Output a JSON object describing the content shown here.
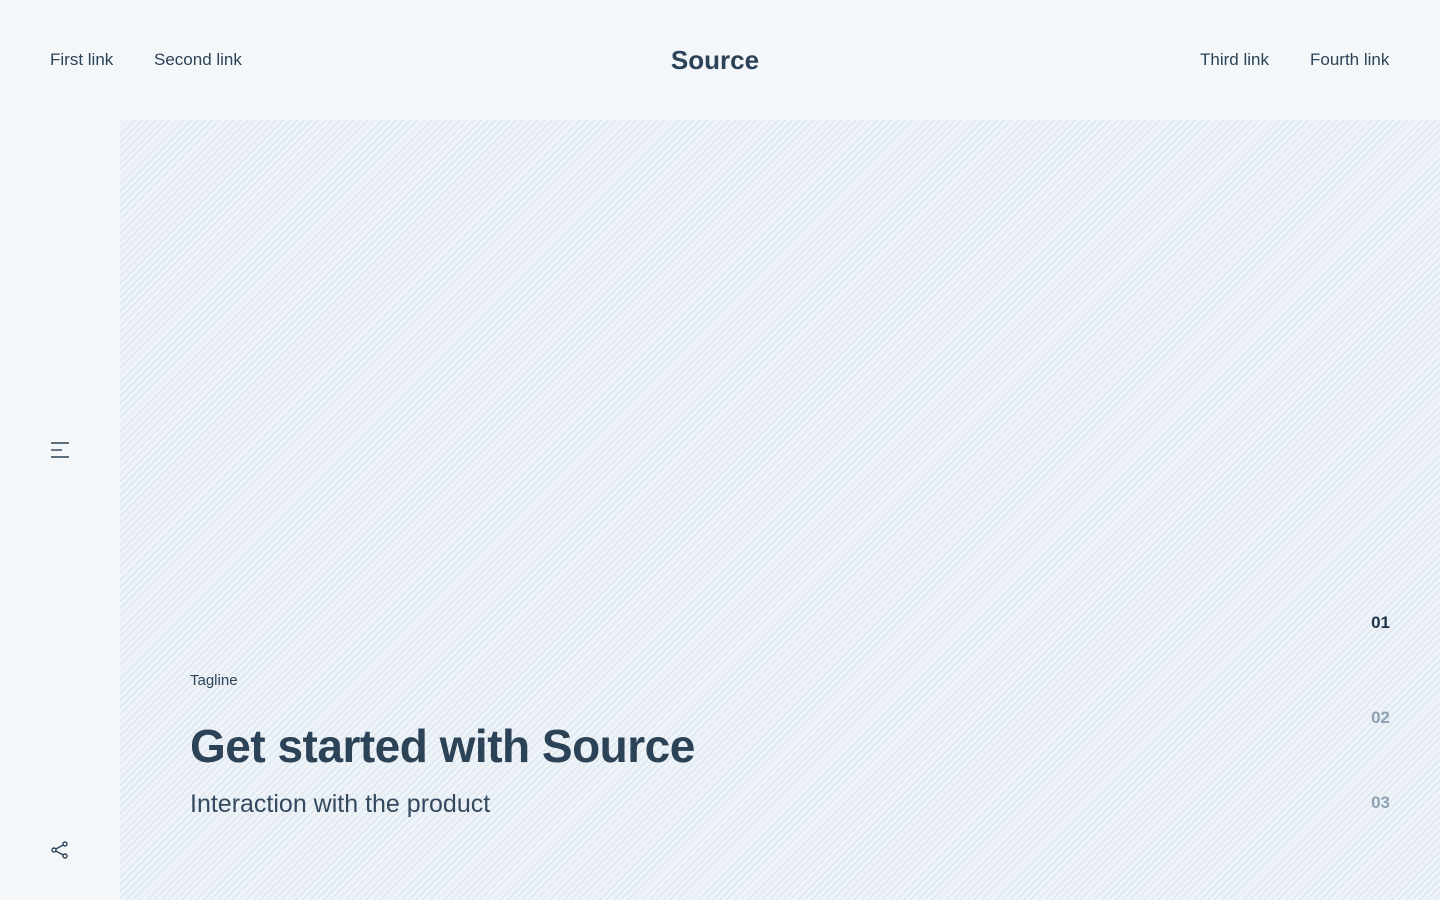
{
  "header": {
    "brand": "Source",
    "links_left": [
      "First link",
      "Second link"
    ],
    "links_right": [
      "Third link",
      "Fourth link"
    ]
  },
  "sidebar": {
    "menu_icon": "menu-icon",
    "share_icon": "share-icon"
  },
  "hero": {
    "tagline": "Tagline",
    "title": "Get started with Source",
    "subtitle": "Interaction with the product"
  },
  "pagination": {
    "items": [
      "01",
      "02",
      "03"
    ],
    "active_index": 0
  },
  "colors": {
    "background": "#f3f7fa",
    "text": "#2c4257",
    "inactive": "#8ea0b3"
  }
}
